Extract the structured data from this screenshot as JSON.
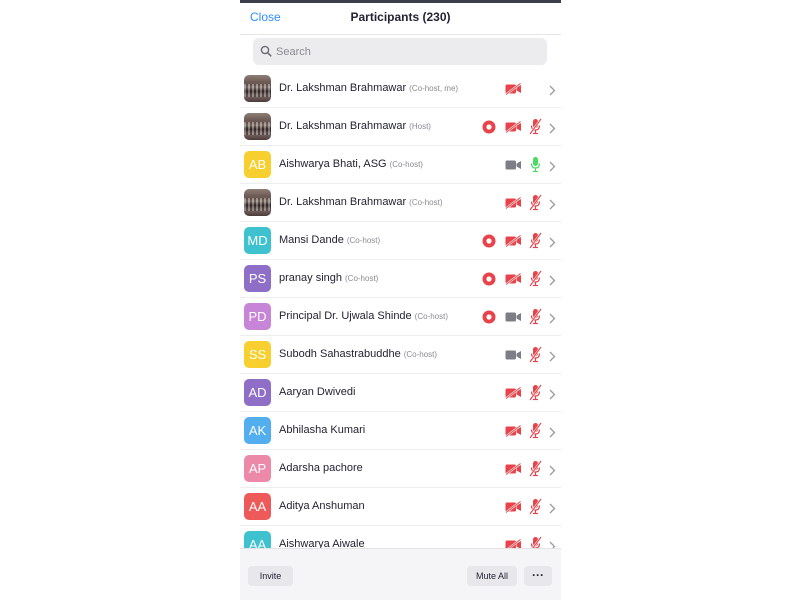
{
  "header": {
    "close_label": "Close",
    "title": "Participants (230)"
  },
  "search": {
    "placeholder": "Search"
  },
  "participants": [
    {
      "name": "Dr. Lakshman Brahmawar",
      "role": "(Co-host, me)",
      "avatar": "photo",
      "recording": false,
      "video": "off",
      "audio": "none"
    },
    {
      "name": "Dr. Lakshman Brahmawar",
      "role": "(Host)",
      "avatar": "photo",
      "recording": true,
      "video": "off",
      "audio": "muted"
    },
    {
      "name": "Aishwarya Bhati, ASG",
      "role": "(Co-host)",
      "initials": "AB",
      "color": "#f7cf2e",
      "recording": false,
      "video": "on",
      "audio": "on"
    },
    {
      "name": "Dr. Lakshman Brahmawar",
      "role": "(Co-host)",
      "avatar": "photo",
      "recording": false,
      "video": "off",
      "audio": "muted"
    },
    {
      "name": "Mansi Dande",
      "role": "(Co-host)",
      "initials": "MD",
      "color": "#3fc2cf",
      "recording": true,
      "video": "off",
      "audio": "muted"
    },
    {
      "name": "pranay singh",
      "role": "(Co-host)",
      "initials": "PS",
      "color": "#8f6ec8",
      "recording": true,
      "video": "off",
      "audio": "muted"
    },
    {
      "name": "Principal Dr. Ujwala Shinde",
      "role": "(Co-host)",
      "initials": "PD",
      "color": "#c685d6",
      "recording": true,
      "video": "on",
      "audio": "muted"
    },
    {
      "name": "Subodh Sahastrabuddhe",
      "role": "(Co-host)",
      "initials": "SS",
      "color": "#f7cf2e",
      "recording": false,
      "video": "on",
      "audio": "muted"
    },
    {
      "name": "Aaryan Dwivedi",
      "role": "",
      "initials": "AD",
      "color": "#8f6ec8",
      "recording": false,
      "video": "off",
      "audio": "muted"
    },
    {
      "name": "Abhilasha Kumari",
      "role": "",
      "initials": "AK",
      "color": "#53aef0",
      "recording": false,
      "video": "off",
      "audio": "muted"
    },
    {
      "name": "Adarsha pachore",
      "role": "",
      "initials": "AP",
      "color": "#ec88a8",
      "recording": false,
      "video": "off",
      "audio": "muted"
    },
    {
      "name": "Aditya Anshuman",
      "role": "",
      "initials": "AA",
      "color": "#ee5a5a",
      "recording": false,
      "video": "off",
      "audio": "muted"
    },
    {
      "name": "Aishwarya Aiwale",
      "role": "",
      "initials": "AA",
      "color": "#3fc2cf",
      "recording": false,
      "video": "off",
      "audio": "muted"
    }
  ],
  "icons": {
    "record": "record-icon",
    "video_off": "video-off-icon",
    "video_on": "video-on-icon",
    "mic_muted": "mic-muted-icon",
    "mic_on": "mic-on-icon",
    "chevron": "chevron-right-icon"
  },
  "colors": {
    "accent": "#2d8cff",
    "alert": "#e8434a",
    "icon_gray": "#7d7d85",
    "mic_on": "#4cd964"
  },
  "footer": {
    "invite_label": "Invite",
    "mute_all_label": "Mute All",
    "more_label": "···"
  }
}
